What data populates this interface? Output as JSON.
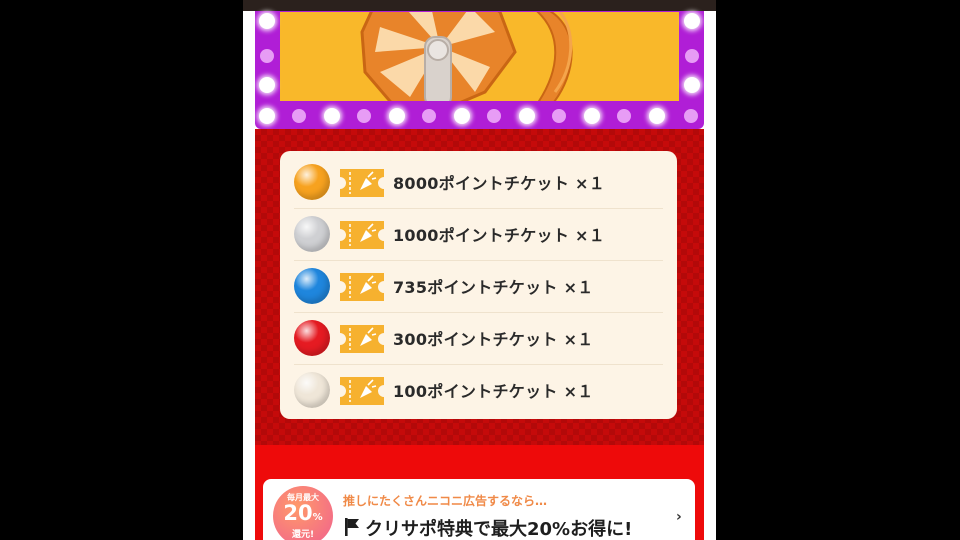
{
  "colors": {
    "frame_purple": "#b01ed6",
    "screen_yellow": "#f9b82a",
    "prize_bg_red": "#c50a0a",
    "list_bg": "#fdf4e6",
    "ticket_orange": "#f6b12f"
  },
  "prizes": [
    {
      "label": "8000ポイントチケット ×１",
      "ball_color": "#f7a21f",
      "icon": "ticket-icon"
    },
    {
      "label": "1000ポイントチケット ×１",
      "ball_color": "#cfd0d3",
      "icon": "ticket-icon"
    },
    {
      "label": "735ポイントチケット ×１",
      "ball_color": "#1f86dd",
      "icon": "ticket-icon"
    },
    {
      "label": "300ポイントチケット ×１",
      "ball_color": "#e51b22",
      "icon": "ticket-icon"
    },
    {
      "label": "100ポイントチケット ×１",
      "ball_color": "#efe6d8",
      "icon": "ticket-icon"
    }
  ],
  "ad": {
    "badge_top": "毎月最大",
    "badge_value": "20",
    "badge_unit": "%",
    "badge_bottom": "還元!",
    "tagline": "推しにたくさんニコニ広告するなら…",
    "headline": "クリサポ特典で最大20%お得に!",
    "flag_icon": "flag-icon",
    "chevron_icon": "chevron-right-icon",
    "chevron": "›"
  }
}
